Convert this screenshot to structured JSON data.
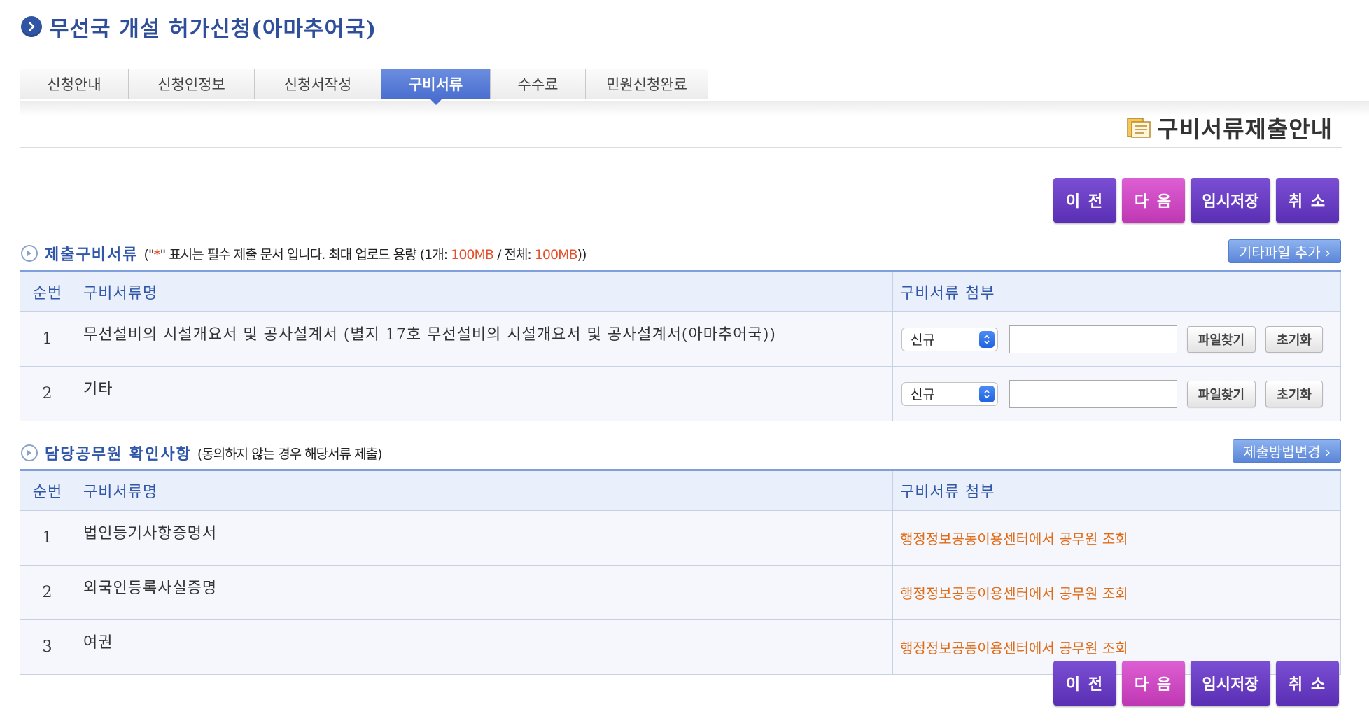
{
  "page": {
    "title": "무선국 개설 허가신청(아마추어국)"
  },
  "tabs": [
    {
      "label": "신청안내"
    },
    {
      "label": "신청인정보"
    },
    {
      "label": "신청서작성"
    },
    {
      "label": "구비서류",
      "active": true
    },
    {
      "label": "수수료"
    },
    {
      "label": "민원신청완료"
    }
  ],
  "heading": {
    "text": "구비서류제출안내",
    "icon": "document-folder-icon"
  },
  "actions": {
    "prev": "이 전",
    "next": "다 음",
    "save": "임시저장",
    "cancel": "취 소"
  },
  "colors": {
    "accent": "#2f56a8",
    "tab_active": "#4a6fcf",
    "button_purple": "#5b2fb4",
    "button_pink": "#bf38b3",
    "highlight_orange": "#e4512c",
    "lookup_orange": "#e06b16"
  },
  "submit_section": {
    "name": "제출구비서류",
    "note_open": "(\"",
    "required_mark": "*",
    "note_mid": "\" 표시는 필수 제출 문서 입니다. 최대 업로드 용량 (1개: ",
    "per_file_limit": "100MB",
    "note_mid2": " / 전체: ",
    "total_limit": "100MB",
    "note_close": "))",
    "add_button": "기타파일 추가 ›",
    "columns": {
      "num": "순번",
      "doc": "구비서류명",
      "attach": "구비서류 첨부"
    },
    "rows": [
      {
        "num": "1",
        "doc": "무선설비의 시설개요서 및 공사설계서 (별지 17호 무선설비의 시설개요서 및 공사설계서(아마추어국))",
        "type": "신규",
        "find": "파일찾기",
        "reset": "초기화"
      },
      {
        "num": "2",
        "doc": "기타",
        "type": "신규",
        "find": "파일찾기",
        "reset": "초기화"
      }
    ]
  },
  "officer_section": {
    "name": "담당공무원 확인사항",
    "note": "(동의하지 않는 경우 해당서류 제출)",
    "change_button": "제출방법변경 ›",
    "columns": {
      "num": "순번",
      "doc": "구비서류명",
      "attach": "구비서류 첨부"
    },
    "rows": [
      {
        "num": "1",
        "doc": "법인등기사항증명서",
        "lookup": "행정정보공동이용센터에서 공무원 조회"
      },
      {
        "num": "2",
        "doc": "외국인등록사실증명",
        "lookup": "행정정보공동이용센터에서 공무원 조회"
      },
      {
        "num": "3",
        "doc": "여권",
        "lookup": "행정정보공동이용센터에서 공무원 조회"
      }
    ]
  }
}
